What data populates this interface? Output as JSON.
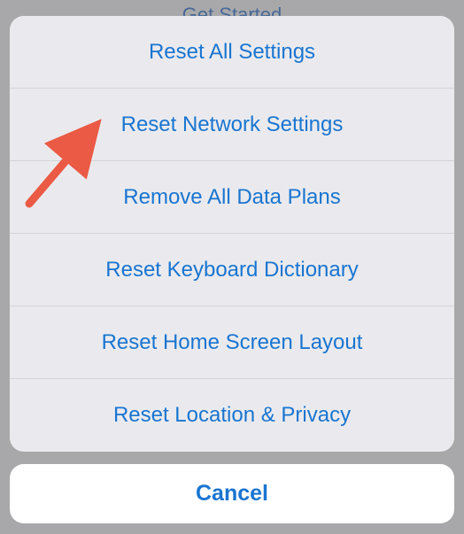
{
  "backdrop": {
    "partial_title": "Get Started"
  },
  "action_sheet": {
    "items": [
      {
        "label": "Reset All Settings"
      },
      {
        "label": "Reset Network Settings"
      },
      {
        "label": "Remove All Data Plans"
      },
      {
        "label": "Reset Keyboard Dictionary"
      },
      {
        "label": "Reset Home Screen Layout"
      },
      {
        "label": "Reset Location & Privacy"
      }
    ],
    "cancel_label": "Cancel"
  },
  "annotation": {
    "arrow_color": "#ea5a44"
  }
}
